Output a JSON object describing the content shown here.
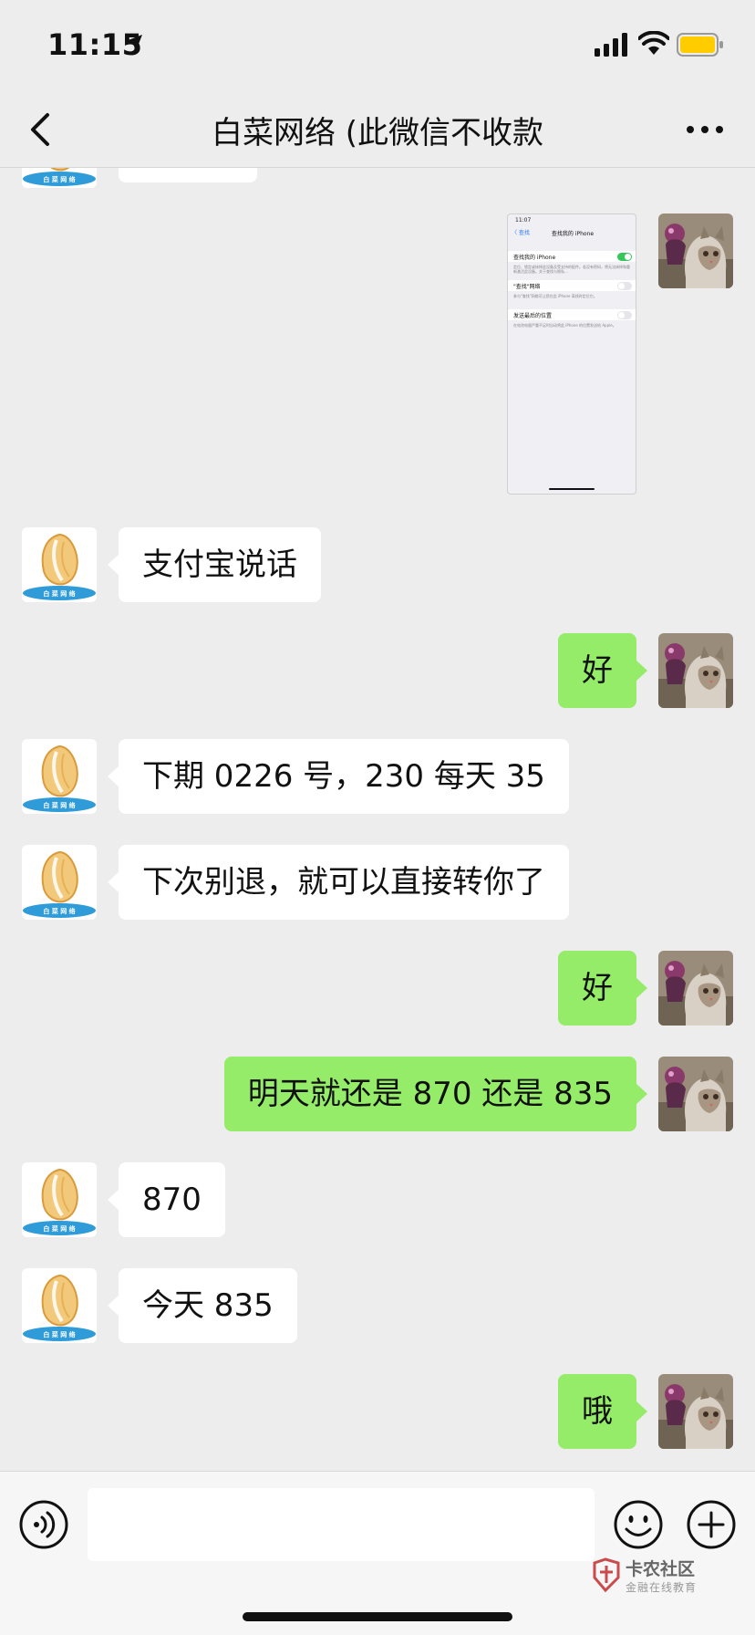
{
  "status_bar": {
    "time": "11:15"
  },
  "header": {
    "title": "白菜网络 (此微信不收款"
  },
  "avatars": {
    "contact_logo_text": "白 菜 网 络",
    "self": "cat-photo"
  },
  "screenshot_thumbnail": {
    "time": "11:07",
    "back": "〈 查找",
    "title": "查找我的 iPhone",
    "rows": [
      {
        "label": "查找我的 iPhone",
        "toggle": "on",
        "note": "定位、锁定或抹掉此设备及受支持的配件。若没有密码，将无法抹掉和重新激活此设备。关于查找与隐私…"
      },
      {
        "label": "\"查找\"网络",
        "toggle": "off",
        "note": "参与\"查找\"网络可让您在此 iPhone 离线时定位它。"
      },
      {
        "label": "发送最后的位置",
        "toggle": "off",
        "note": "在电池电量严重不足时自动将此 iPhone 的位置发送给 Apple。"
      }
    ]
  },
  "messages": [
    {
      "sender": "them",
      "text": "支付宝说话"
    },
    {
      "sender": "me",
      "text": "好"
    },
    {
      "sender": "them",
      "text": "下期 0226 号，230 每天 35"
    },
    {
      "sender": "them",
      "text": "下次别退，就可以直接转你了"
    },
    {
      "sender": "me",
      "text": "好"
    },
    {
      "sender": "me",
      "text": "明天就还是 870 还是 835"
    },
    {
      "sender": "them",
      "text": "870"
    },
    {
      "sender": "them",
      "text": "今天 835"
    },
    {
      "sender": "me",
      "text": "哦"
    }
  ],
  "watermark": {
    "title": "卡农社区",
    "subtitle": "金融在线教育"
  },
  "colors": {
    "background": "#ededed",
    "outgoing_bubble": "#95ec69",
    "incoming_bubble": "#ffffff"
  }
}
